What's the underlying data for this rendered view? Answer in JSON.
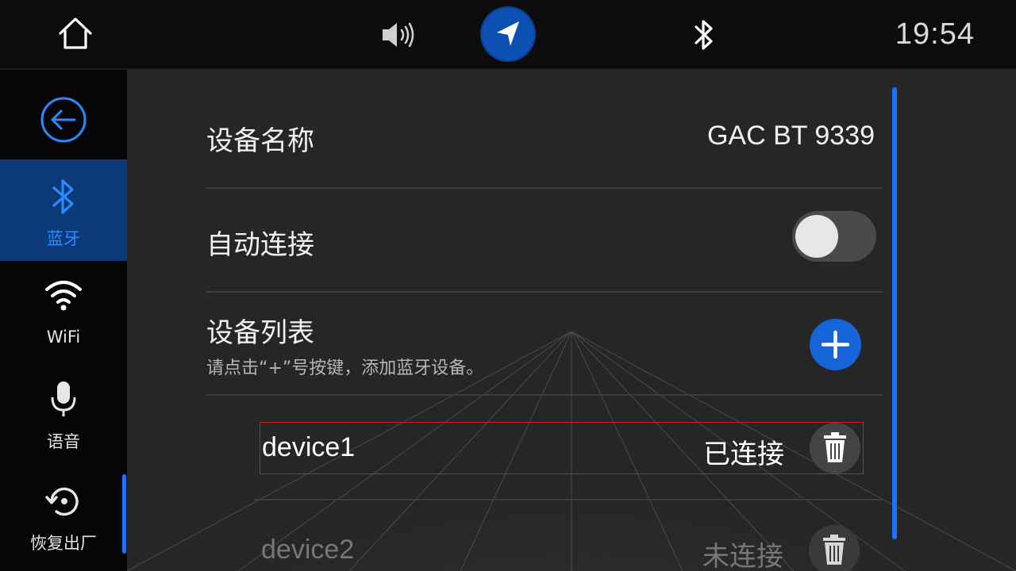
{
  "statusbar": {
    "clock": "19:54",
    "icons": [
      "home-icon",
      "volume-icon",
      "navigation-icon",
      "bluetooth-icon"
    ],
    "accent": "#0d4fb3"
  },
  "sidebar": {
    "back_icon": "back-arrow-icon",
    "items": [
      {
        "label": "蓝牙",
        "icon": "bluetooth-icon",
        "active": true
      },
      {
        "label": "WiFi",
        "icon": "wifi-icon",
        "active": false
      },
      {
        "label": "语音",
        "icon": "microphone-icon",
        "active": false
      },
      {
        "label": "恢复出厂",
        "icon": "factory-reset-icon",
        "active": false
      }
    ]
  },
  "settings": {
    "device_name_label": "设备名称",
    "device_name_value": "GAC BT 9339",
    "auto_connect_label": "自动连接",
    "auto_connect_on": false,
    "device_list_label": "设备列表",
    "device_list_hint": "请点击“+”号按键，添加蓝牙设备。",
    "devices": [
      {
        "name": "device1",
        "status": "已连接",
        "icon": "trash-icon"
      },
      {
        "name": "device2",
        "status": "未连接",
        "icon": "trash-icon"
      }
    ]
  },
  "colors": {
    "active_blue": "#2a8bff",
    "active_bg": "#0c3a78",
    "button_blue": "#1565d8"
  }
}
